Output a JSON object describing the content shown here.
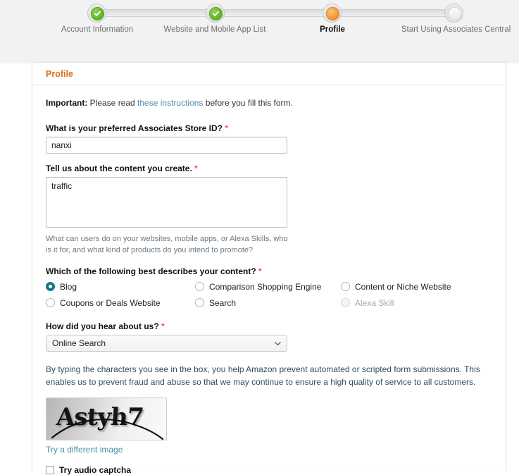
{
  "progress": {
    "steps": [
      {
        "label": "Account Information",
        "state": "done",
        "icon": "check-circle-icon"
      },
      {
        "label": "Website and Mobile App List",
        "state": "done",
        "icon": "check-circle-icon"
      },
      {
        "label": "Profile",
        "state": "current",
        "icon": "current-step-icon"
      },
      {
        "label": "Start Using Associates Central",
        "state": "todo",
        "icon": "empty-step-icon"
      }
    ]
  },
  "card": {
    "title": "Profile",
    "important": {
      "prefix": "Important:",
      "before_link": " Please read ",
      "link": "these instructions",
      "after_link": " before you fill this form."
    },
    "store_id": {
      "label": "What is your preferred Associates Store ID?",
      "required_mark": "*",
      "value": "nanxi",
      "placeholder": ""
    },
    "content_desc": {
      "label": "Tell us about the content you create.",
      "required_mark": "*",
      "value": "traffic",
      "placeholder": "",
      "hint": "What can users do on your websites, mobile apps, or Alexa Skills, who is it for, and what kind of products do you intend to promote?"
    },
    "content_type": {
      "label": "Which of the following best describes your content?",
      "required_mark": "*",
      "options": [
        {
          "label": "Blog",
          "checked": true,
          "disabled": false
        },
        {
          "label": "Comparison Shopping Engine",
          "checked": false,
          "disabled": false
        },
        {
          "label": "Content or Niche Website",
          "checked": false,
          "disabled": false
        },
        {
          "label": "Coupons or Deals Website",
          "checked": false,
          "disabled": false
        },
        {
          "label": "Search",
          "checked": false,
          "disabled": false
        },
        {
          "label": "Alexa Skill",
          "checked": false,
          "disabled": true
        }
      ]
    },
    "hear_about": {
      "label": "How did you hear about us?",
      "required_mark": "*",
      "selected": "Online Search",
      "chevron_icon": "chevron-down-icon"
    },
    "captcha": {
      "intro": "By typing the characters you see in the box, you help Amazon prevent automated or scripted form submissions. This enables us to prevent fraud and abuse so that we may continue to ensure a high quality of service to all customers.",
      "image_text": "Astyh7",
      "image_icon": "captcha-image",
      "refresh_link": "Try a different image",
      "audio_label": "Try audio captcha",
      "audio_checked": false
    }
  },
  "colors": {
    "accent_orange": "#d9701a",
    "link_blue": "#4a8fa8",
    "required_red": "#e45b5b",
    "radio_teal": "#0d7b8c",
    "step_done_green": "#5cb226",
    "step_current_orange": "#ef8f29",
    "page_bg": "#f2f2f2"
  }
}
